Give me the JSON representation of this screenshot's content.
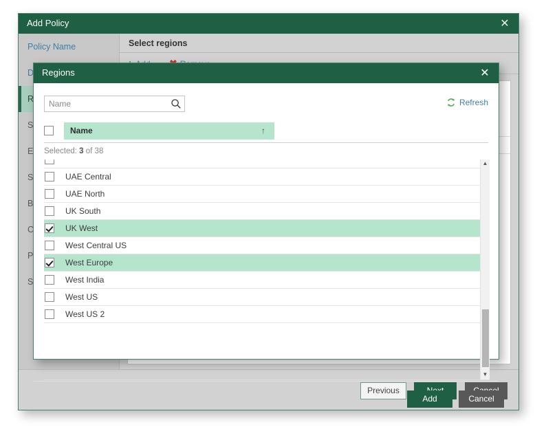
{
  "outer_window": {
    "title": "Add Policy",
    "close_icon": "close-icon",
    "sidebar": [
      {
        "label": "Policy Name",
        "state": "link"
      },
      {
        "label": "Dir",
        "state": "link"
      },
      {
        "label": "Reg",
        "state": "active"
      },
      {
        "label": "Spe",
        "state": "normal"
      },
      {
        "label": "Exc",
        "state": "normal"
      },
      {
        "label": "Sna",
        "state": "normal"
      },
      {
        "label": "Bac",
        "state": "normal"
      },
      {
        "label": "Cos",
        "state": "normal"
      },
      {
        "label": "Pol",
        "state": "normal"
      },
      {
        "label": "Sur",
        "state": "normal"
      }
    ],
    "content": {
      "header": "Select regions",
      "toolbar": {
        "add_label": "Add",
        "add_glyph": "+",
        "remove_label": "Remove",
        "remove_glyph": "✖"
      }
    },
    "footer": {
      "previous_label": "Previous",
      "next_label": "Next",
      "cancel_label": "Cancel"
    }
  },
  "regions_dialog": {
    "title": "Regions",
    "close_icon": "close-icon",
    "search": {
      "value": "",
      "placeholder": "Name",
      "icon": "search-icon"
    },
    "refresh": {
      "label": "Refresh",
      "icon": "refresh-icon"
    },
    "table": {
      "header_checkbox_checked": false,
      "columns": [
        {
          "label": "Name",
          "sort": "↑",
          "sort_direction": "ascending"
        }
      ],
      "selected_text_prefix": "Selected:",
      "selected_count": "3",
      "selected_of": "of 38",
      "total": 38,
      "rows": [
        {
          "label": "",
          "checked": false,
          "partial": true
        },
        {
          "label": "UAE Central",
          "checked": false
        },
        {
          "label": "UAE North",
          "checked": false
        },
        {
          "label": "UK South",
          "checked": false
        },
        {
          "label": "UK West",
          "checked": true
        },
        {
          "label": "West Central US",
          "checked": false
        },
        {
          "label": "West Europe",
          "checked": true
        },
        {
          "label": "West India",
          "checked": false
        },
        {
          "label": "West US",
          "checked": false
        },
        {
          "label": "West US 2",
          "checked": false
        }
      ]
    },
    "scrollbar": {
      "up_glyph": "▲",
      "down_glyph": "▼"
    },
    "footer": {
      "add_label": "Add",
      "cancel_label": "Cancel"
    }
  },
  "colors": {
    "brand_green": "#1f6044",
    "selection_green": "#b6e5cd",
    "link_blue": "#3f7faa",
    "gray_button": "#585858",
    "add_plus_green": "#3da64a",
    "remove_x_red": "#c0392b"
  }
}
